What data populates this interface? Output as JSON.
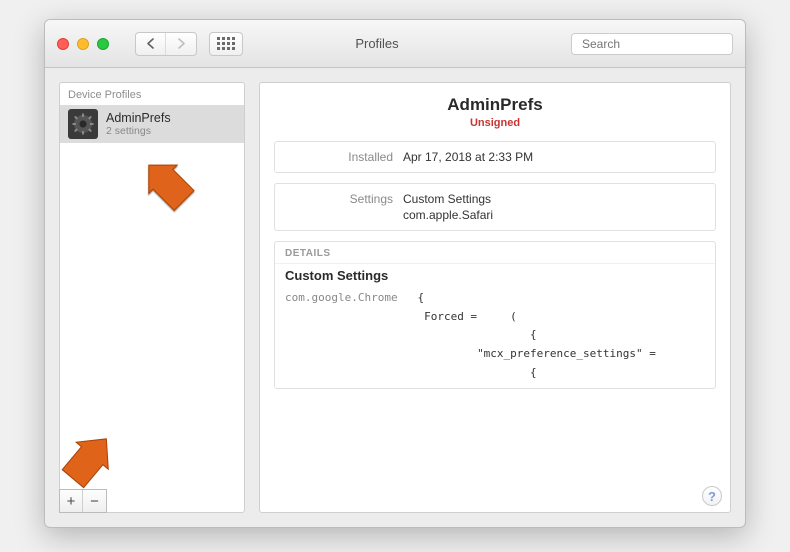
{
  "toolbar": {
    "title": "Profiles",
    "search_placeholder": "Search"
  },
  "sidebar": {
    "header": "Device Profiles",
    "item": {
      "name": "AdminPrefs",
      "subtitle": "2 settings"
    },
    "add_label": "+",
    "remove_label": "−"
  },
  "main": {
    "title": "AdminPrefs",
    "status": "Unsigned",
    "installed_label": "Installed",
    "installed_value": "Apr 17, 2018 at 2:33 PM",
    "settings_label": "Settings",
    "settings_value_1": "Custom Settings",
    "settings_value_2": "com.apple.Safari",
    "details_header": "DETAILS",
    "details_title": "Custom Settings",
    "code_domain": "com.google.Chrome",
    "code_line_1": "{",
    "code_line_2": "Forced =     (",
    "code_line_3": "{",
    "code_line_4": "\"mcx_preference_settings\" =",
    "code_line_5": "{",
    "help": "?"
  }
}
